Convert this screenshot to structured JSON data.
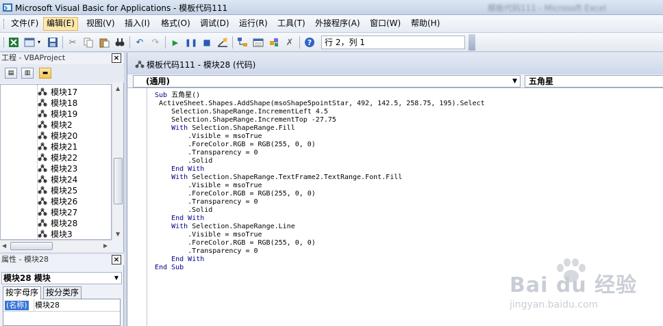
{
  "window": {
    "title": "Microsoft Visual Basic for Applications - 模板代码111",
    "excel_title": "模板代码111 - Microsoft Excel"
  },
  "menu": {
    "items": [
      "文件(F)",
      "编辑(E)",
      "视图(V)",
      "插入(I)",
      "格式(O)",
      "调试(D)",
      "运行(R)",
      "工具(T)",
      "外接程序(A)",
      "窗口(W)",
      "帮助(H)"
    ],
    "active_item": "编辑(E)"
  },
  "toolbar": {
    "icons": [
      "excel-icon",
      "insert-userform-icon",
      "save-icon",
      "cut-icon",
      "copy-icon",
      "paste-icon",
      "find-icon",
      "undo-icon",
      "redo-icon",
      "run-icon",
      "break-icon",
      "reset-icon",
      "design-mode-icon",
      "project-explorer-icon",
      "properties-icon",
      "object-browser-icon",
      "toolbox-icon",
      "help-icon"
    ],
    "cursor_position": "行 2，列 1"
  },
  "project_panel": {
    "title": "工程 - VBAProject",
    "close_label": "×",
    "tree_items": [
      "模块17",
      "模块18",
      "模块19",
      "模块2",
      "模块20",
      "模块21",
      "模块22",
      "模块23",
      "模块24",
      "模块25",
      "模块26",
      "模块27",
      "模块28",
      "模块3"
    ]
  },
  "properties_panel": {
    "title": "属性 - 模块28",
    "close_label": "×",
    "object_name": "模块28 模块",
    "tabs": [
      "按字母序",
      "按分类序"
    ],
    "property_name": "(名称)",
    "property_value": "模块28"
  },
  "code_window": {
    "title": "模板代码111 - 模块28 (代码)",
    "object_dropdown": "(通用)",
    "procedure_dropdown": "五角星",
    "code_lines": [
      "Sub 五角星()",
      " ActiveSheet.Shapes.AddShape(msoShape5pointStar, 492, 142.5, 258.75, 195).Select",
      "    Selection.ShapeRange.IncrementLeft 4.5",
      "    Selection.ShapeRange.IncrementTop -27.75",
      "    With Selection.ShapeRange.Fill",
      "        .Visible = msoTrue",
      "        .ForeColor.RGB = RGB(255, 0, 0)",
      "        .Transparency = 0",
      "        .Solid",
      "    End With",
      "    With Selection.ShapeRange.TextFrame2.TextRange.Font.Fill",
      "        .Visible = msoTrue",
      "        .ForeColor.RGB = RGB(255, 0, 0)",
      "        .Transparency = 0",
      "        .Solid",
      "    End With",
      "    With Selection.ShapeRange.Line",
      "        .Visible = msoTrue",
      "        .ForeColor.RGB = RGB(255, 0, 0)",
      "        .Transparency = 0",
      "    End With",
      "End Sub"
    ]
  },
  "watermark": {
    "logo": "Bai du 经验",
    "url": "jingyan.baidu.com"
  },
  "colors": {
    "keyword": "#00008b",
    "active_menu": "#fde9b0",
    "selection": "#3875d7"
  }
}
